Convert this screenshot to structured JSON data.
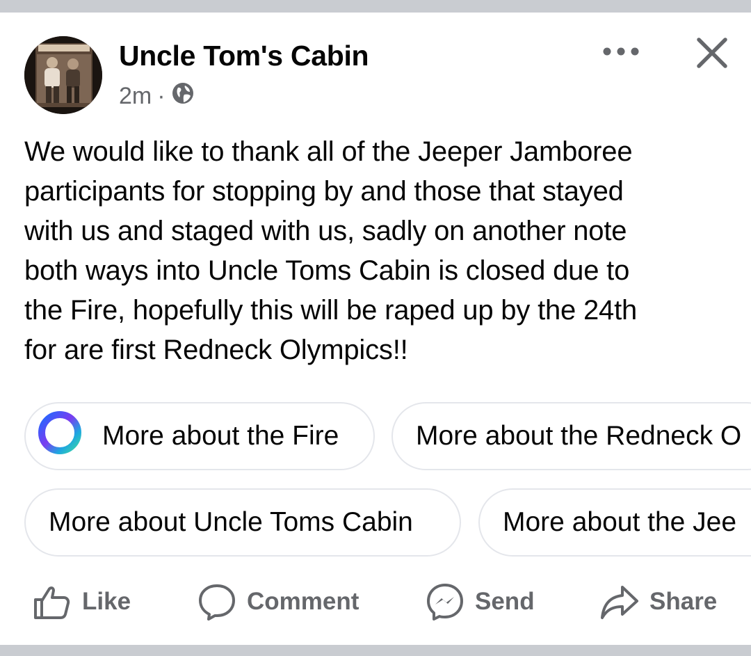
{
  "post": {
    "author": "Uncle Tom's Cabin",
    "time": "2m",
    "separator": "·",
    "privacy_icon": "globe-icon",
    "text": "We would like to thank all of the Jeeper Jamboree\nparticipants for stopping by and those that stayed\nwith us and staged with us, sadly on another note\nboth ways into Uncle Toms Cabin is closed due to\nthe Fire, hopefully this will be raped up by the 24th\nfor are first Redneck Olympics!!"
  },
  "header_icons": [
    "more-options-icon",
    "close-icon"
  ],
  "suggestions": [
    {
      "label": "More about the Fire",
      "icon": "meta-ai-ring-icon"
    },
    {
      "label": "More about the Redneck O"
    },
    {
      "label": "More about Uncle Toms Cabin"
    },
    {
      "label": "More about the Jee"
    }
  ],
  "actions": {
    "like": "Like",
    "comment": "Comment",
    "send": "Send",
    "share": "Share"
  },
  "colors": {
    "text": "#050505",
    "secondary": "#65676b",
    "divider": "#c9ccd1",
    "chip_border": "#e4e6eb"
  }
}
